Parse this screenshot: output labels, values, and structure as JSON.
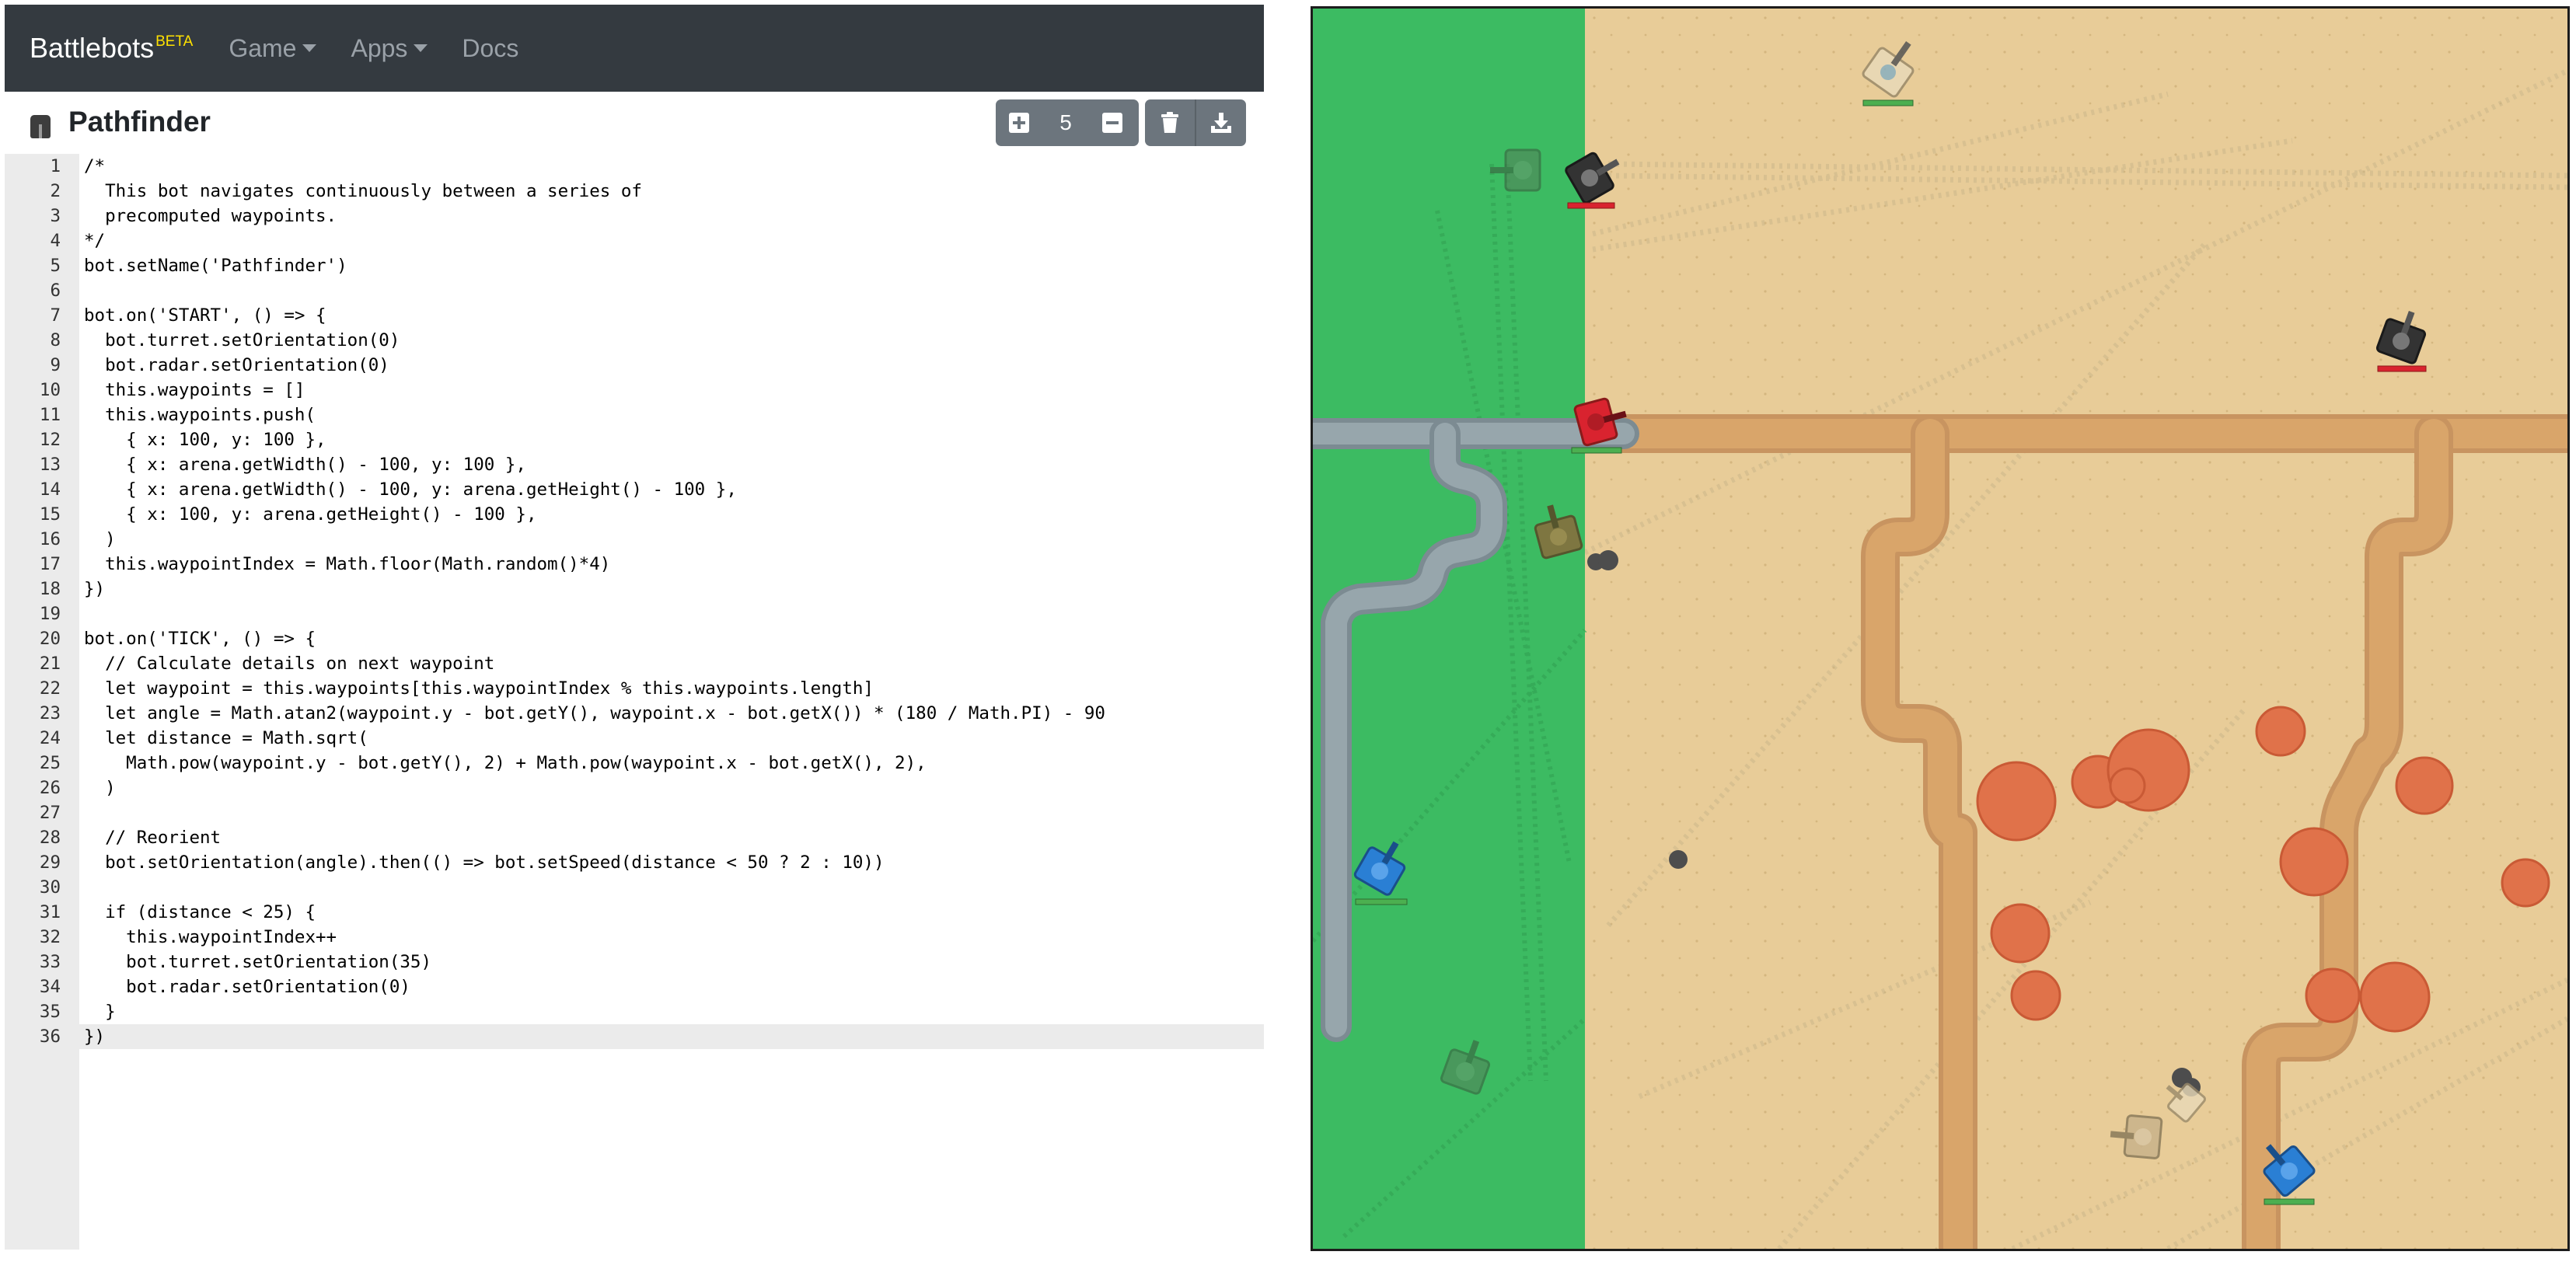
{
  "navbar": {
    "brand": "Battlebots",
    "beta": "BETA",
    "items": [
      {
        "label": "Game",
        "dropdown": true
      },
      {
        "label": "Apps",
        "dropdown": true
      },
      {
        "label": "Docs",
        "dropdown": false
      }
    ]
  },
  "titlebar": {
    "bot_name": "Pathfinder",
    "bot_count": "5",
    "buttons": [
      {
        "icon": "plus-square-icon"
      },
      {
        "icon": "minus-square-icon"
      },
      {
        "icon": "trash-icon"
      },
      {
        "icon": "download-icon"
      }
    ]
  },
  "editor": {
    "active_line": 36,
    "lines": [
      "/*",
      "  This bot navigates continuously between a series of",
      "  precomputed waypoints.",
      "*/",
      "bot.setName('Pathfinder')",
      "",
      "bot.on('START', () => {",
      "  bot.turret.setOrientation(0)",
      "  bot.radar.setOrientation(0)",
      "  this.waypoints = []",
      "  this.waypoints.push(",
      "    { x: 100, y: 100 },",
      "    { x: arena.getWidth() - 100, y: 100 },",
      "    { x: arena.getWidth() - 100, y: arena.getHeight() - 100 },",
      "    { x: 100, y: arena.getHeight() - 100 },",
      "  )",
      "  this.waypointIndex = Math.floor(Math.random()*4)",
      "})",
      "",
      "bot.on('TICK', () => {",
      "  // Calculate details on next waypoint",
      "  let waypoint = this.waypoints[this.waypointIndex % this.waypoints.length]",
      "  let angle = Math.atan2(waypoint.y - bot.getY(), waypoint.x - bot.getX()) * (180 / Math.PI) - 90",
      "  let distance = Math.sqrt(",
      "    Math.pow(waypoint.y - bot.getY(), 2) + Math.pow(waypoint.x - bot.getX(), 2),",
      "  )",
      "",
      "  // Reorient",
      "  bot.setOrientation(angle).then(() => bot.setSpeed(distance < 50 ? 2 : 10))",
      "",
      "  if (distance < 25) {",
      "    this.waypointIndex++",
      "    bot.turret.setOrientation(35)",
      "    bot.radar.setOrientation(0)",
      "  }",
      "})"
    ]
  },
  "arena": {
    "colors": {
      "grass": "#3cbb62",
      "sand": "#e8cc98",
      "road": "#d9a56a",
      "water": "#8a9aa0",
      "bush": "#e0724a"
    },
    "tanks": [
      {
        "name": "tank-gray-top",
        "color": "#e8d9b8",
        "health": "green"
      },
      {
        "name": "tank-dark-green",
        "color": "#4f8a5a",
        "health": "none"
      },
      {
        "name": "tank-black-top",
        "color": "#333333",
        "health": "red"
      },
      {
        "name": "tank-black-right",
        "color": "#333333",
        "health": "red"
      },
      {
        "name": "tank-red",
        "color": "#d9232f",
        "health": "green"
      },
      {
        "name": "tank-brown",
        "color": "#8a6a3c",
        "health": "none"
      },
      {
        "name": "tank-blue-left",
        "color": "#2a7fd4",
        "health": "green"
      },
      {
        "name": "tank-green-bottom",
        "color": "#4f8a5a",
        "health": "none"
      },
      {
        "name": "tank-tan-bottom",
        "color": "#c9b38b",
        "health": "none"
      },
      {
        "name": "tank-blue-bottom",
        "color": "#2a7fd4",
        "health": "green"
      }
    ]
  }
}
